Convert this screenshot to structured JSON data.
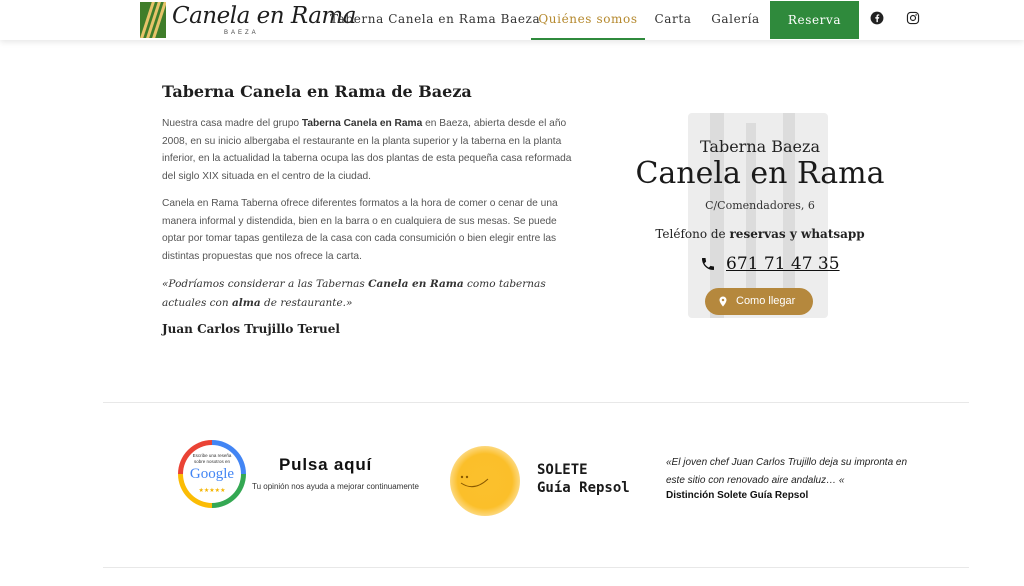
{
  "header": {
    "logo_text": "Canela en Rama",
    "logo_sub": "BAEZA",
    "nav": [
      {
        "label": "Taberna Canela en Rama Baeza",
        "active": false
      },
      {
        "label": "Quiénes somos",
        "active": true
      },
      {
        "label": "Carta",
        "active": false
      },
      {
        "label": "Galería",
        "active": false
      }
    ],
    "cta_label": "Reserva",
    "social_icons": [
      "facebook-icon",
      "instagram-icon"
    ]
  },
  "main": {
    "title": "Taberna Canela en Rama de Baeza",
    "p1": {
      "a": "Nuestra casa madre del grupo ",
      "b": "Taberna Canela en Rama",
      "c": " en Baeza, abierta desde el año 2008, en su inicio albergaba el restaurante en la planta superior y la taberna en la planta inferior, en la actualidad la taberna ocupa las dos plantas de esta pequeña casa reformada del siglo XIX situada en el centro de la ciudad."
    },
    "p2": "Canela en Rama Taberna ofrece diferentes formatos a la hora de comer o cenar de una manera informal y distendida, bien en la barra o en cualquiera de sus mesas. Se puede optar por tomar tapas gentileza de la casa con cada consumición o bien elegir entre las distintas propuestas que nos ofrece la carta.",
    "quote": {
      "a": "«Podríamos considerar a las Tabernas ",
      "b": "Canela en Rama",
      "c": " como tabernas actuales con ",
      "d": "alma",
      "e": " de restaurante.»"
    },
    "author": "Juan Carlos Trujillo Teruel"
  },
  "card": {
    "small": "Taberna Baeza",
    "big": "Canela en Rama",
    "address": "C/Comendadores, 6",
    "tel_label_a": "Teléfono de ",
    "tel_label_b": "reservas y whatsapp",
    "phone": "671 71 47 35",
    "map_button": "Como llegar"
  },
  "bottom": {
    "badge_line1": "Escribe una reseña",
    "badge_line2": "sobre nosotros en",
    "badge_brand": "Google",
    "badge_stars": "★★★★★",
    "pulsa_title": "Pulsa aquí",
    "pulsa_sub": "Tu opinión nos ayuda a mejorar continuamente",
    "solete_line1": "SOLETE",
    "solete_line2": "Guía Repsol",
    "quote": "«El joven chef Juan Carlos Trujillo deja su impronta en este sitio con renovado aire andaluz… «",
    "quote_src": "Distinción Solete Guía Repsol"
  },
  "colors": {
    "green": "#2f8a3c",
    "gold": "#b5892e",
    "button_brown": "#b5883d"
  }
}
